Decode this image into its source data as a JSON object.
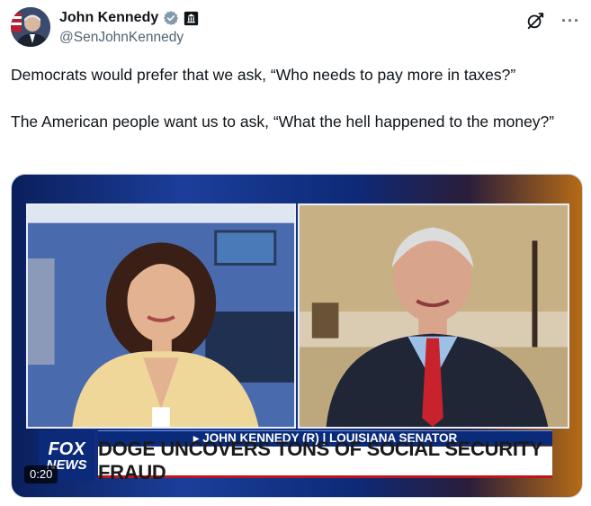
{
  "author": {
    "display_name": "John Kennedy",
    "handle": "@SenJohnKennedy",
    "verified_badge": "verified-gray-badge-icon",
    "affiliation_icon": "government-building-icon"
  },
  "actions": {
    "grok_icon": "grok-icon",
    "more_icon": "more-options-icon",
    "more_label": "···"
  },
  "post": {
    "paragraphs": [
      "Democrats would prefer that we ask, “Who needs to pay more in taxes?”",
      "The American people want us to ask, “What the hell happened to the money?”"
    ]
  },
  "video": {
    "timestamp": "0:20",
    "channel_logo_top": "FOX",
    "channel_logo_bottom": "NEWS",
    "nameplate": "▸ JOHN KENNEDY (R) | LOUISIANA SENATOR",
    "headline": "DOGE UNCOVERS TONS OF SOCIAL SECURITY FRAUD"
  },
  "colors": {
    "text_primary": "#0f1419",
    "text_secondary": "#536471",
    "fox_blue": "#0a2b7a",
    "border": "#cfd9de"
  }
}
